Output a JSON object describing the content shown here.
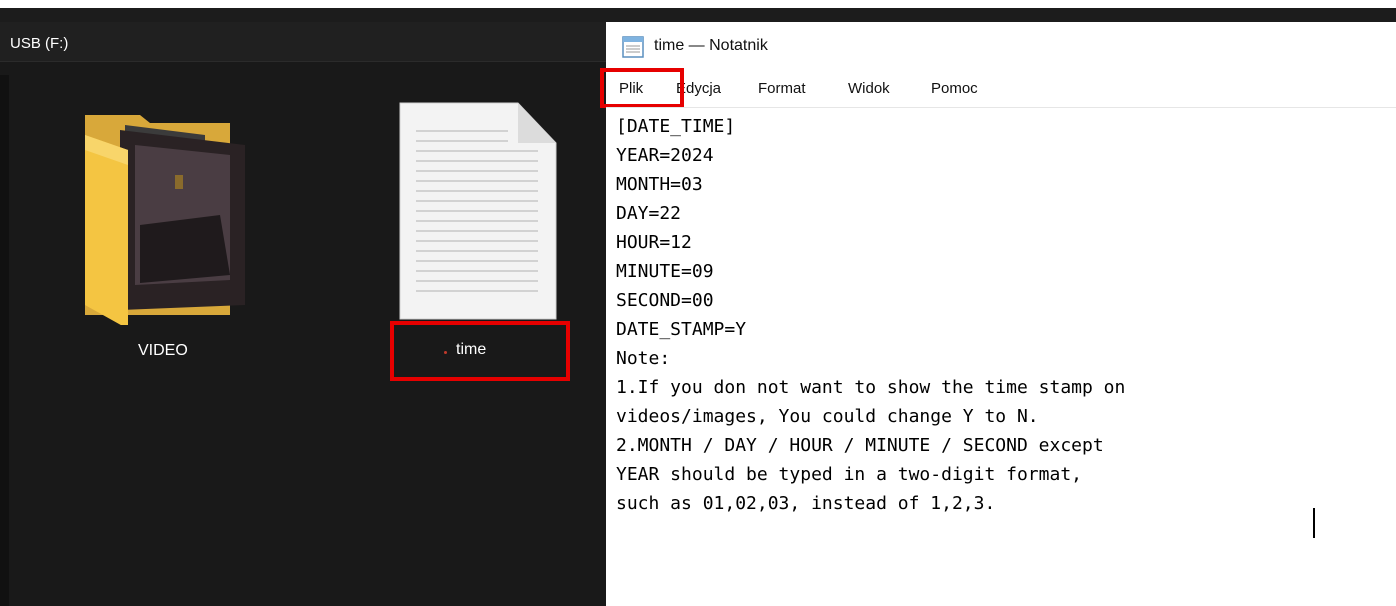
{
  "explorer": {
    "title": "USB (F:)",
    "items": [
      {
        "name": "VIDEO",
        "type": "folder",
        "icon": "folder-with-video-preview-icon"
      },
      {
        "name": "time",
        "type": "text-file",
        "icon": "text-file-icon"
      }
    ]
  },
  "notepad": {
    "title": "time — Notatnik",
    "menu": [
      "Plik",
      "Edycja",
      "Format",
      "Widok",
      "Pomoc"
    ],
    "lines": [
      "[DATE_TIME]",
      "YEAR=2024",
      "MONTH=03",
      "DAY=22",
      "HOUR=12",
      "MINUTE=09",
      "SECOND=00",
      "DATE_STAMP=Y",
      "Note:",
      "1.If you don not want to show the time stamp on",
      "videos/images, You could change Y to N.",
      "2.MONTH / DAY / HOUR / MINUTE / SECOND except",
      "YEAR should be typed in a two-digit format,",
      "such as 01,02,03, instead of 1,2,3."
    ]
  },
  "colors": {
    "explorer_bg": "#191919",
    "highlight": "#e60000",
    "folder_yellow": "#f4c542"
  }
}
